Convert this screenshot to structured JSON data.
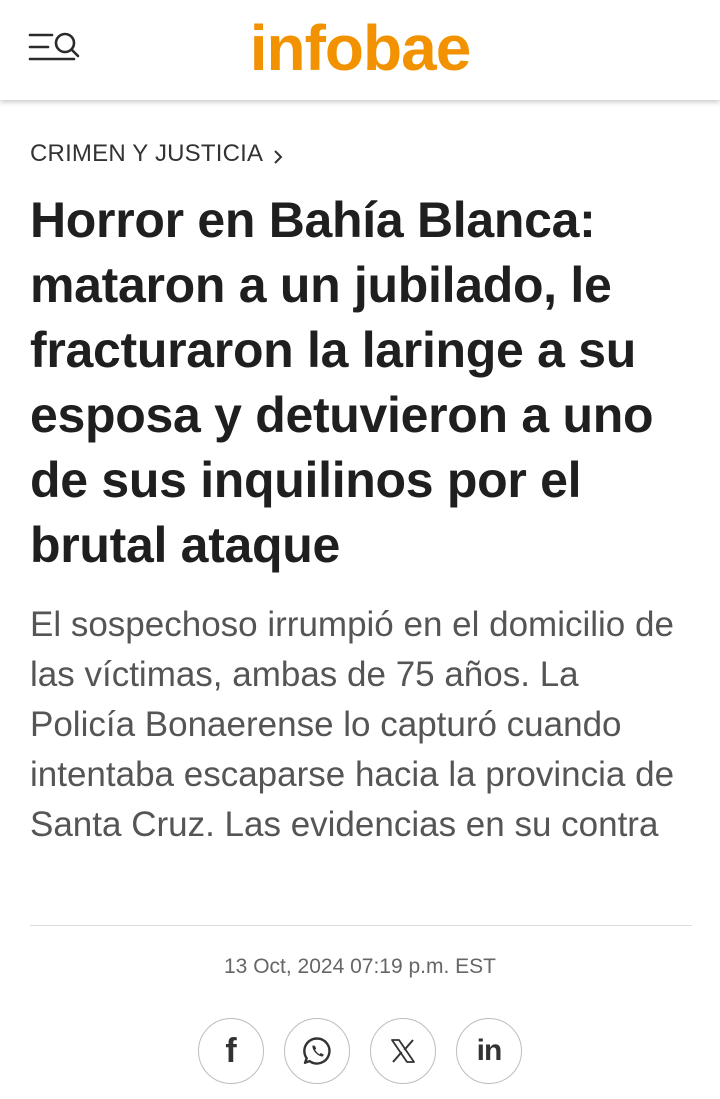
{
  "header": {
    "logo_text": "infobae",
    "menu_icon": "menu-search-icon",
    "brand_color": "#f39200"
  },
  "article": {
    "section": "CRIMEN Y JUSTICIA",
    "headline": "Horror en Bahía Blanca: mataron a un jubilado, le fracturaron la laringe a su esposa y detuvieron a uno de sus inquilinos por el brutal ataque",
    "summary": "El sospechoso irrumpió en el domicilio de las víctimas, ambas de 75 años. La Policía Bonaerense lo capturó cuando intentaba escaparse hacia la provincia de Santa Cruz. Las evidencias en su contra",
    "date": "13 Oct, 2024 07:19 p.m. EST"
  },
  "share": {
    "facebook_glyph": "f",
    "linkedin_glyph": "in",
    "icons": [
      "facebook-icon",
      "whatsapp-icon",
      "x-icon",
      "linkedin-icon"
    ]
  }
}
